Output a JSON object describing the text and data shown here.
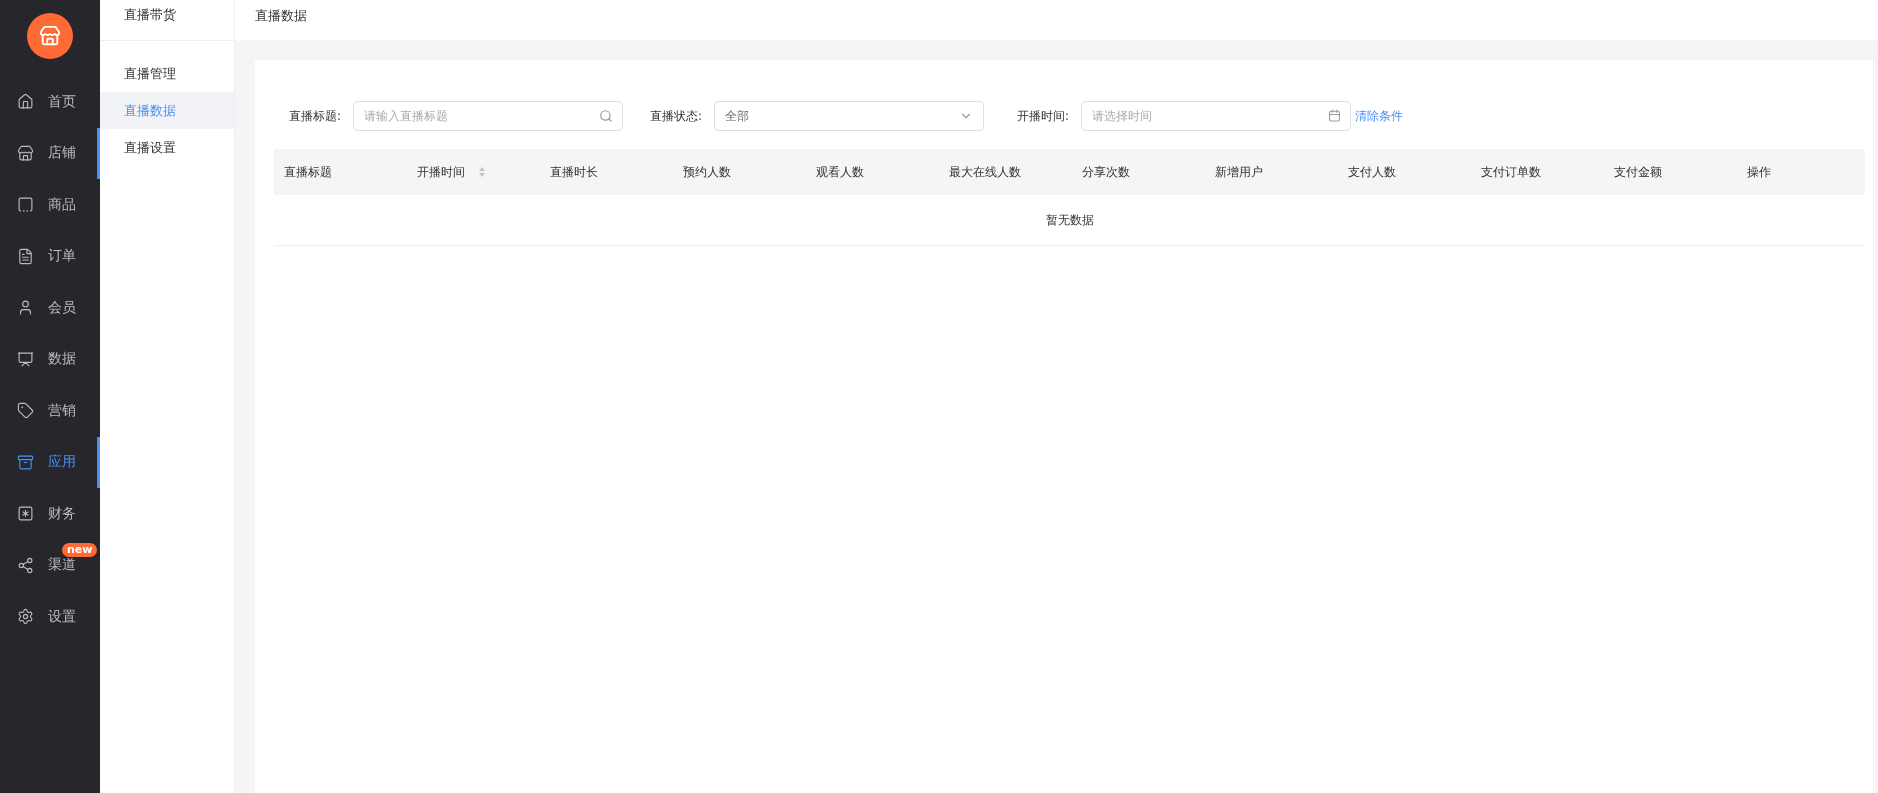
{
  "nav": {
    "items": [
      {
        "label": "首页",
        "selected": false,
        "indicator": false
      },
      {
        "label": "店铺",
        "selected": false,
        "indicator": true
      },
      {
        "label": "商品",
        "selected": false,
        "indicator": false
      },
      {
        "label": "订单",
        "selected": false,
        "indicator": false
      },
      {
        "label": "会员",
        "selected": false,
        "indicator": false
      },
      {
        "label": "数据",
        "selected": false,
        "indicator": false
      },
      {
        "label": "营销",
        "selected": false,
        "indicator": false
      },
      {
        "label": "应用",
        "selected": true,
        "indicator": true
      },
      {
        "label": "财务",
        "selected": false,
        "indicator": false
      },
      {
        "label": "渠道",
        "selected": false,
        "indicator": false,
        "badge": "new"
      },
      {
        "label": "设置",
        "selected": false,
        "indicator": false
      }
    ]
  },
  "subnav": {
    "title": "直播带货",
    "items": [
      {
        "label": "直播管理",
        "selected": false
      },
      {
        "label": "直播数据",
        "selected": true
      },
      {
        "label": "直播设置",
        "selected": false
      }
    ]
  },
  "page_title": "直播数据",
  "filters": {
    "title": {
      "label": "直播标题:",
      "placeholder": "请输入直播标题"
    },
    "status": {
      "label": "直播状态:",
      "value": "全部"
    },
    "time": {
      "label": "开播时间:",
      "placeholder": "请选择时间"
    },
    "clear": "清除条件"
  },
  "table": {
    "columns": [
      {
        "label": "直播标题",
        "sortable": false
      },
      {
        "label": "开播时间",
        "sortable": true
      },
      {
        "label": "直播时长",
        "sortable": false
      },
      {
        "label": "预约人数",
        "sortable": false
      },
      {
        "label": "观看人数",
        "sortable": false
      },
      {
        "label": "最大在线人数",
        "sortable": false
      },
      {
        "label": "分享次数",
        "sortable": false
      },
      {
        "label": "新增用户",
        "sortable": false
      },
      {
        "label": "支付人数",
        "sortable": false
      },
      {
        "label": "支付订单数",
        "sortable": false
      },
      {
        "label": "支付金额",
        "sortable": false
      },
      {
        "label": "操作",
        "sortable": false
      }
    ],
    "empty": "暂无数据"
  }
}
